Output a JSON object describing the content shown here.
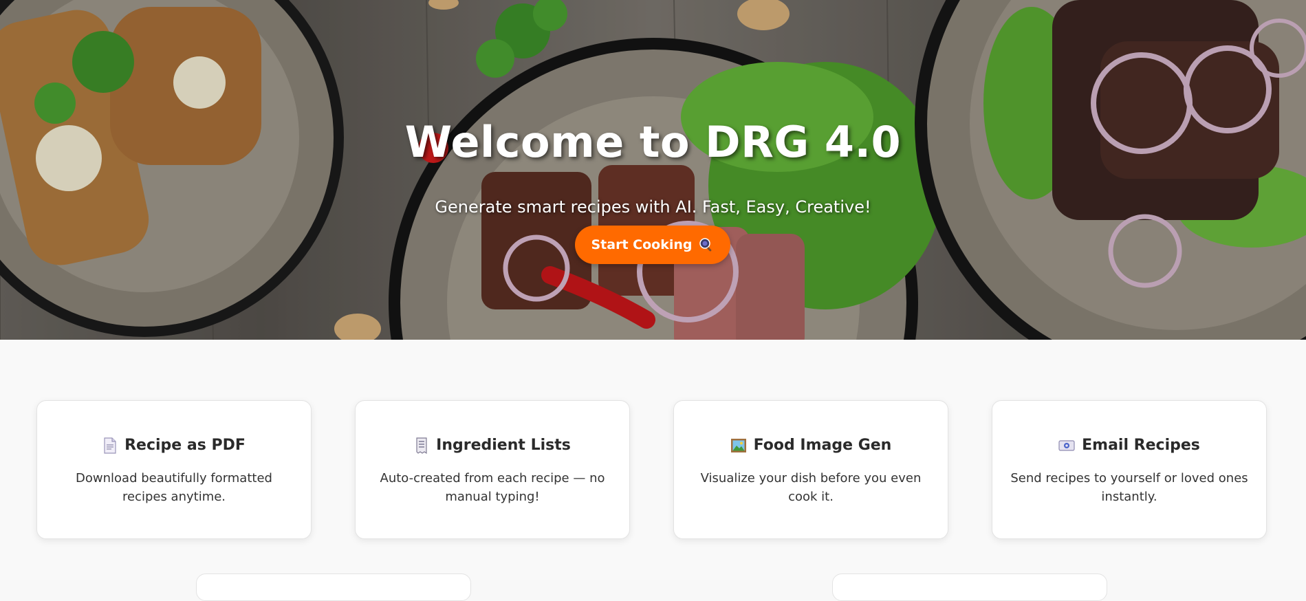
{
  "hero": {
    "title": "Welcome to DRG 4.0",
    "subtitle": "Generate smart recipes with AI. Fast, Easy, Creative!",
    "cta_label": "Start Cooking",
    "cta_icon": "frying-pan-icon",
    "cta_color": "#ff6a00",
    "background": "food-plates-photo"
  },
  "features": [
    {
      "icon": "document-icon",
      "title": "Recipe as PDF",
      "description": "Download beautifully formatted recipes anytime."
    },
    {
      "icon": "receipt-list-icon",
      "title": "Ingredient Lists",
      "description": "Auto-created from each recipe — no manual typing!"
    },
    {
      "icon": "framed-picture-icon",
      "title": "Food Image Gen",
      "description": "Visualize your dish before you even cook it."
    },
    {
      "icon": "email-icon",
      "title": "Email Recipes",
      "description": "Send recipes to yourself or loved ones instantly."
    }
  ]
}
